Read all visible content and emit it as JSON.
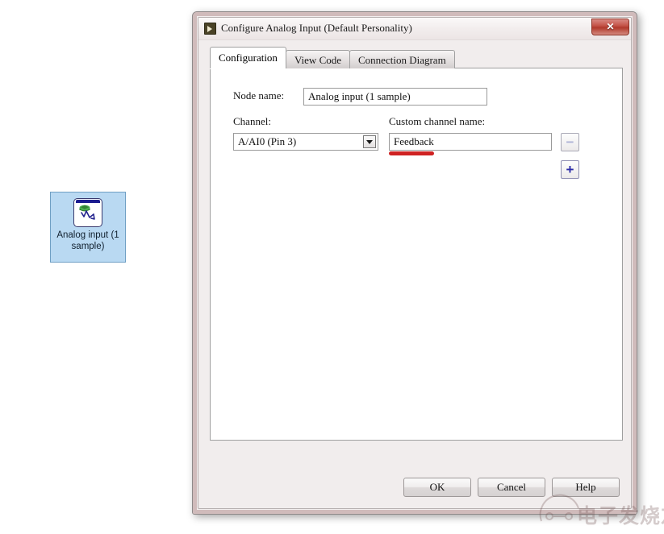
{
  "canvas": {
    "node": {
      "icon_name": "analog-input-node-icon",
      "label": "Analog input (1 sample)",
      "fill_color": "#b9d9f2",
      "border_color": "#6f9fc4"
    }
  },
  "dialog": {
    "title": "Configure Analog Input (Default Personality)",
    "title_icon": "labview-vi-icon",
    "close_label": "✕",
    "close_icon": "close-icon",
    "tabs": [
      {
        "label": "Configuration",
        "active": true
      },
      {
        "label": "View Code",
        "active": false
      },
      {
        "label": "Connection Diagram",
        "active": false
      }
    ],
    "form": {
      "node_name_label": "Node name:",
      "node_name_value": "Analog input (1 sample)",
      "channel_label": "Channel:",
      "channel_value": "A/AI0 (Pin 3)",
      "channel_options": [
        "A/AI0 (Pin 3)"
      ],
      "custom_channel_label": "Custom channel name:",
      "custom_channel_value": "Feedback",
      "remove_channel_label": "−",
      "add_channel_label": "+",
      "highlight_color": "#cf2222"
    },
    "buttons": {
      "ok": "OK",
      "cancel": "Cancel",
      "help": "Help"
    }
  },
  "watermark": {
    "text": "电子发烧友",
    "icon_name": "circuit-node-logo-icon"
  }
}
